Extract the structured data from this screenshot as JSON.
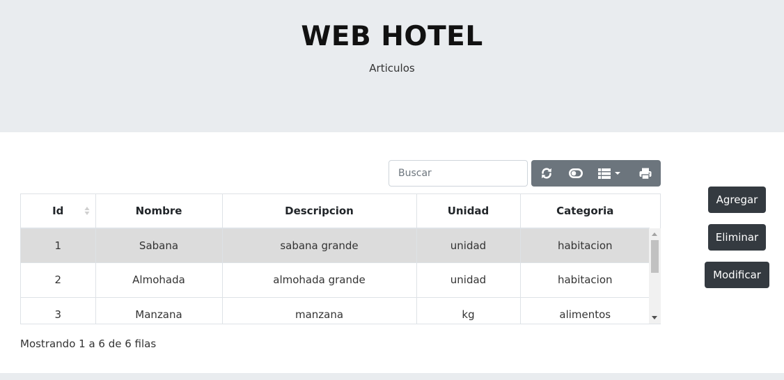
{
  "header": {
    "title": "WEB HOTEL",
    "subtitle": "Articulos"
  },
  "search": {
    "placeholder": "Buscar",
    "value": ""
  },
  "toolbar": {
    "buttons": [
      "refresh-icon",
      "toggle-icon",
      "columns-icon",
      "print-icon"
    ]
  },
  "table": {
    "columns": [
      "Id",
      "Nombre",
      "Descripcion",
      "Unidad",
      "Categoria"
    ],
    "rows": [
      [
        "1",
        "Sabana",
        "sabana grande",
        "unidad",
        "habitacion"
      ],
      [
        "2",
        "Almohada",
        "almohada grande",
        "unidad",
        "habitacion"
      ],
      [
        "3",
        "Manzana",
        "manzana",
        "kg",
        "alimentos"
      ]
    ],
    "selected_row": 0
  },
  "pagination": {
    "info": "Mostrando 1 a 6 de 6 filas"
  },
  "actions": {
    "add_label": "Agregar",
    "delete_label": "Eliminar",
    "edit_label": "Modificar"
  },
  "colors": {
    "header_bg": "#e9ecef",
    "toolbar_bg": "#6c757d",
    "action_bg": "#343a40",
    "selected_row_bg": "#dcdcdc"
  }
}
